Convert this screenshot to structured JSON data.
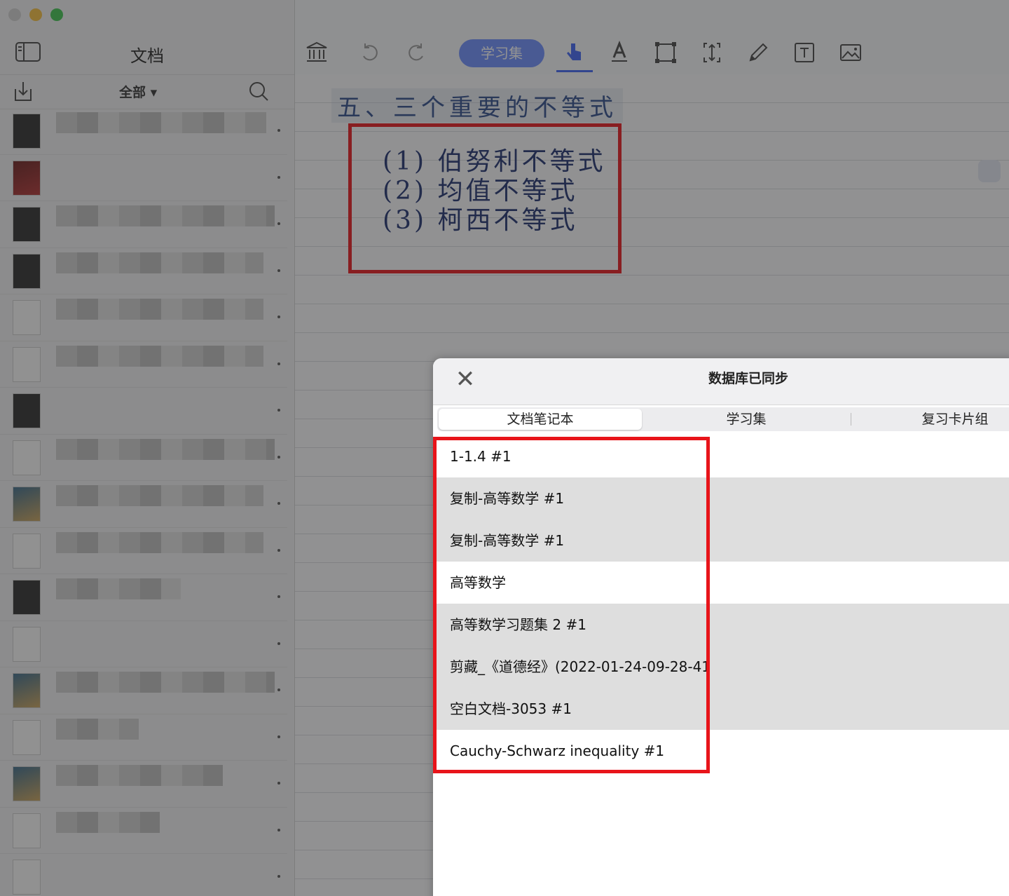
{
  "sidebar": {
    "title": "文档",
    "filter_label": "全部 ▾",
    "docs": [
      {
        "thumb": "dark",
        "blur": 300
      },
      {
        "thumb": "red",
        "blur": 0
      },
      {
        "thumb": "dark",
        "blur": 312
      },
      {
        "thumb": "dark",
        "blur": 296
      },
      {
        "thumb": "light",
        "blur": 296
      },
      {
        "thumb": "light",
        "blur": 296
      },
      {
        "thumb": "dark",
        "blur": 0
      },
      {
        "thumb": "light",
        "blur": 312
      },
      {
        "thumb": "color",
        "blur": 296
      },
      {
        "thumb": "light",
        "blur": 296
      },
      {
        "thumb": "dark",
        "blur": 178
      },
      {
        "thumb": "light",
        "blur": 0
      },
      {
        "thumb": "color",
        "blur": 312
      },
      {
        "thumb": "light",
        "blur": 118
      },
      {
        "thumb": "color",
        "blur": 238
      },
      {
        "thumb": "light",
        "blur": 148
      },
      {
        "thumb": "light",
        "blur": 0
      }
    ]
  },
  "toolbar": {
    "study_set_tab": "学习集"
  },
  "note": {
    "heading": "五、三个重要的不等式",
    "lines": [
      "(1) 伯努利不等式",
      "(2) 均值不等式",
      "(3) 柯西不等式"
    ]
  },
  "modal": {
    "title": "数据库已同步",
    "tabs": [
      "文档笔记本",
      "学习集",
      "复习卡片组"
    ],
    "items": [
      "1-1.4 #1",
      "复制-高等数学 #1",
      "复制-高等数学 #1",
      "高等数学",
      "高等数学习题集 2 #1",
      "剪藏_《道德经》(2022-01-24-09-28-41",
      "空白文档-3053 #1",
      "Cauchy-Schwarz inequality #1"
    ]
  }
}
